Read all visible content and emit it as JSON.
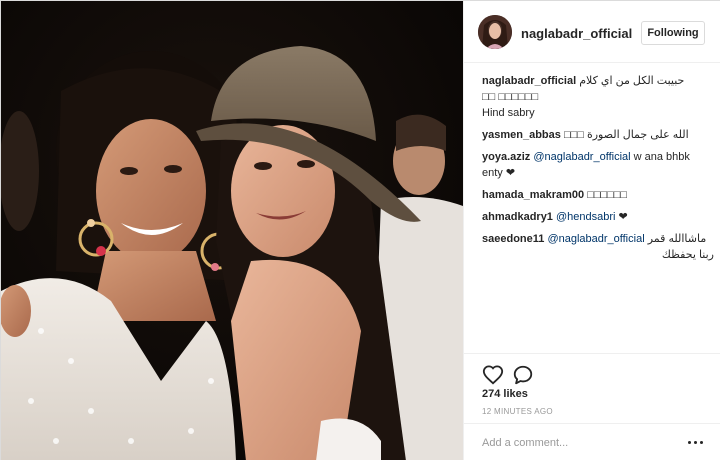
{
  "post": {
    "username": "naglabadr_official",
    "follow_label": "Following",
    "caption": {
      "username": "naglabadr_official",
      "text": "حبيبت الكل من اي كلام □□□□□□ □□",
      "second_line": "Hind sabry"
    },
    "comments": [
      {
        "username": "yasmen_abbas",
        "text": "الله على جمال الصورة □□□"
      },
      {
        "username": "yoya.aziz",
        "mention": "@naglabadr_official",
        "text": "w ana bhbk",
        "second_line": "enty ❤"
      },
      {
        "username": "hamada_makram00",
        "text": "□□□□□□"
      },
      {
        "username": "ahmadkadry1",
        "mention": "@hendsabri",
        "text": "❤"
      },
      {
        "username": "saeedone11",
        "mention": "@naglabadr_official",
        "text": "ماشاالله قمر",
        "second_line": "ربنا يحفظك"
      }
    ],
    "likes": "274 likes",
    "time": "12 MINUTES AGO",
    "comment_placeholder": "Add a comment..."
  },
  "icons": {
    "like": "heart-icon",
    "comment": "comment-bubble-icon",
    "more": "more-options-icon"
  },
  "colors": {
    "text": "#262626",
    "mention": "#003569",
    "muted": "#999999",
    "border": "#dbdbdb"
  }
}
